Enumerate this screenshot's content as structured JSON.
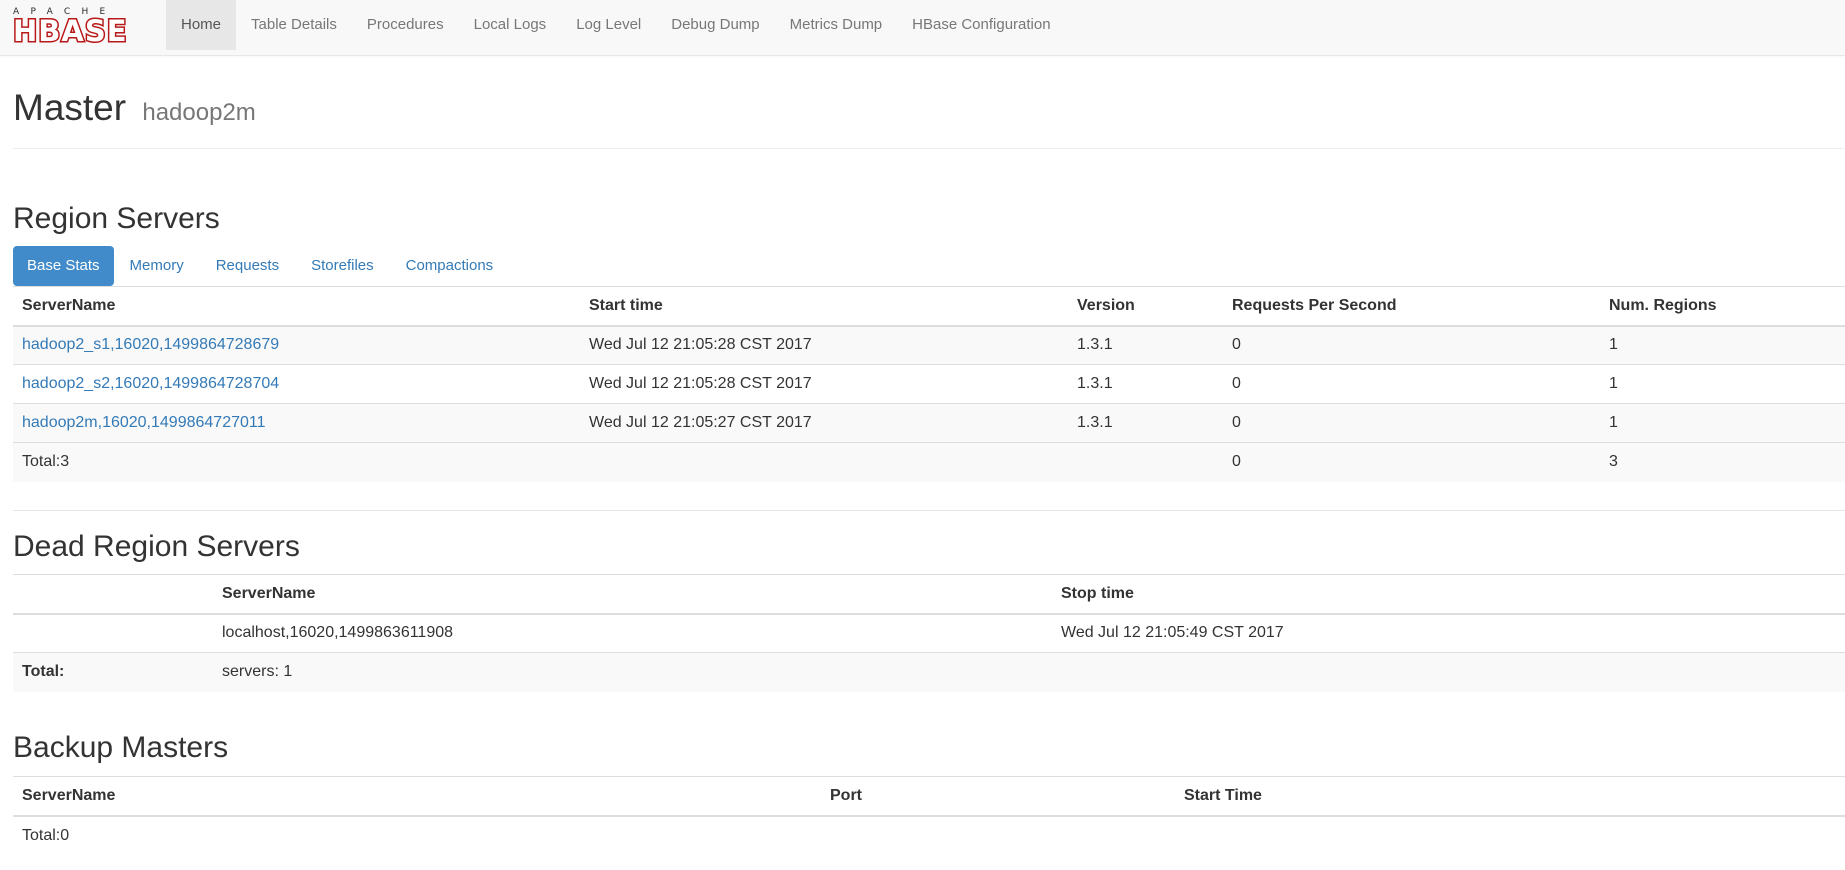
{
  "logo": {
    "top_text": "APACHE",
    "main_text": "HBASE"
  },
  "nav": {
    "items": [
      {
        "label": "Home"
      },
      {
        "label": "Table Details"
      },
      {
        "label": "Procedures"
      },
      {
        "label": "Local Logs"
      },
      {
        "label": "Log Level"
      },
      {
        "label": "Debug Dump"
      },
      {
        "label": "Metrics Dump"
      },
      {
        "label": "HBase Configuration"
      }
    ],
    "active": "Home"
  },
  "header": {
    "title": "Master",
    "subtitle": "hadoop2m"
  },
  "region_servers": {
    "title": "Region Servers",
    "tabs": [
      {
        "label": "Base Stats"
      },
      {
        "label": "Memory"
      },
      {
        "label": "Requests"
      },
      {
        "label": "Storefiles"
      },
      {
        "label": "Compactions"
      }
    ],
    "active_tab": "Base Stats",
    "columns": [
      "ServerName",
      "Start time",
      "Version",
      "Requests Per Second",
      "Num. Regions"
    ],
    "rows": [
      {
        "server": "hadoop2_s1,16020,1499864728679",
        "start": "Wed Jul 12 21:05:28 CST 2017",
        "version": "1.3.1",
        "rps": "0",
        "regions": "1"
      },
      {
        "server": "hadoop2_s2,16020,1499864728704",
        "start": "Wed Jul 12 21:05:28 CST 2017",
        "version": "1.3.1",
        "rps": "0",
        "regions": "1"
      },
      {
        "server": "hadoop2m,16020,1499864727011",
        "start": "Wed Jul 12 21:05:27 CST 2017",
        "version": "1.3.1",
        "rps": "0",
        "regions": "1"
      }
    ],
    "total": {
      "label": "Total:3",
      "rps": "0",
      "regions": "3"
    }
  },
  "dead_servers": {
    "title": "Dead Region Servers",
    "columns": [
      "",
      "ServerName",
      "Stop time"
    ],
    "rows": [
      {
        "server": "localhost,16020,1499863611908",
        "stop": "Wed Jul 12 21:05:49 CST 2017"
      }
    ],
    "total": {
      "label": "Total:",
      "value": "servers: 1"
    }
  },
  "backup_masters": {
    "title": "Backup Masters",
    "columns": [
      "ServerName",
      "Port",
      "Start Time"
    ],
    "total": {
      "label": "Total:0"
    }
  }
}
